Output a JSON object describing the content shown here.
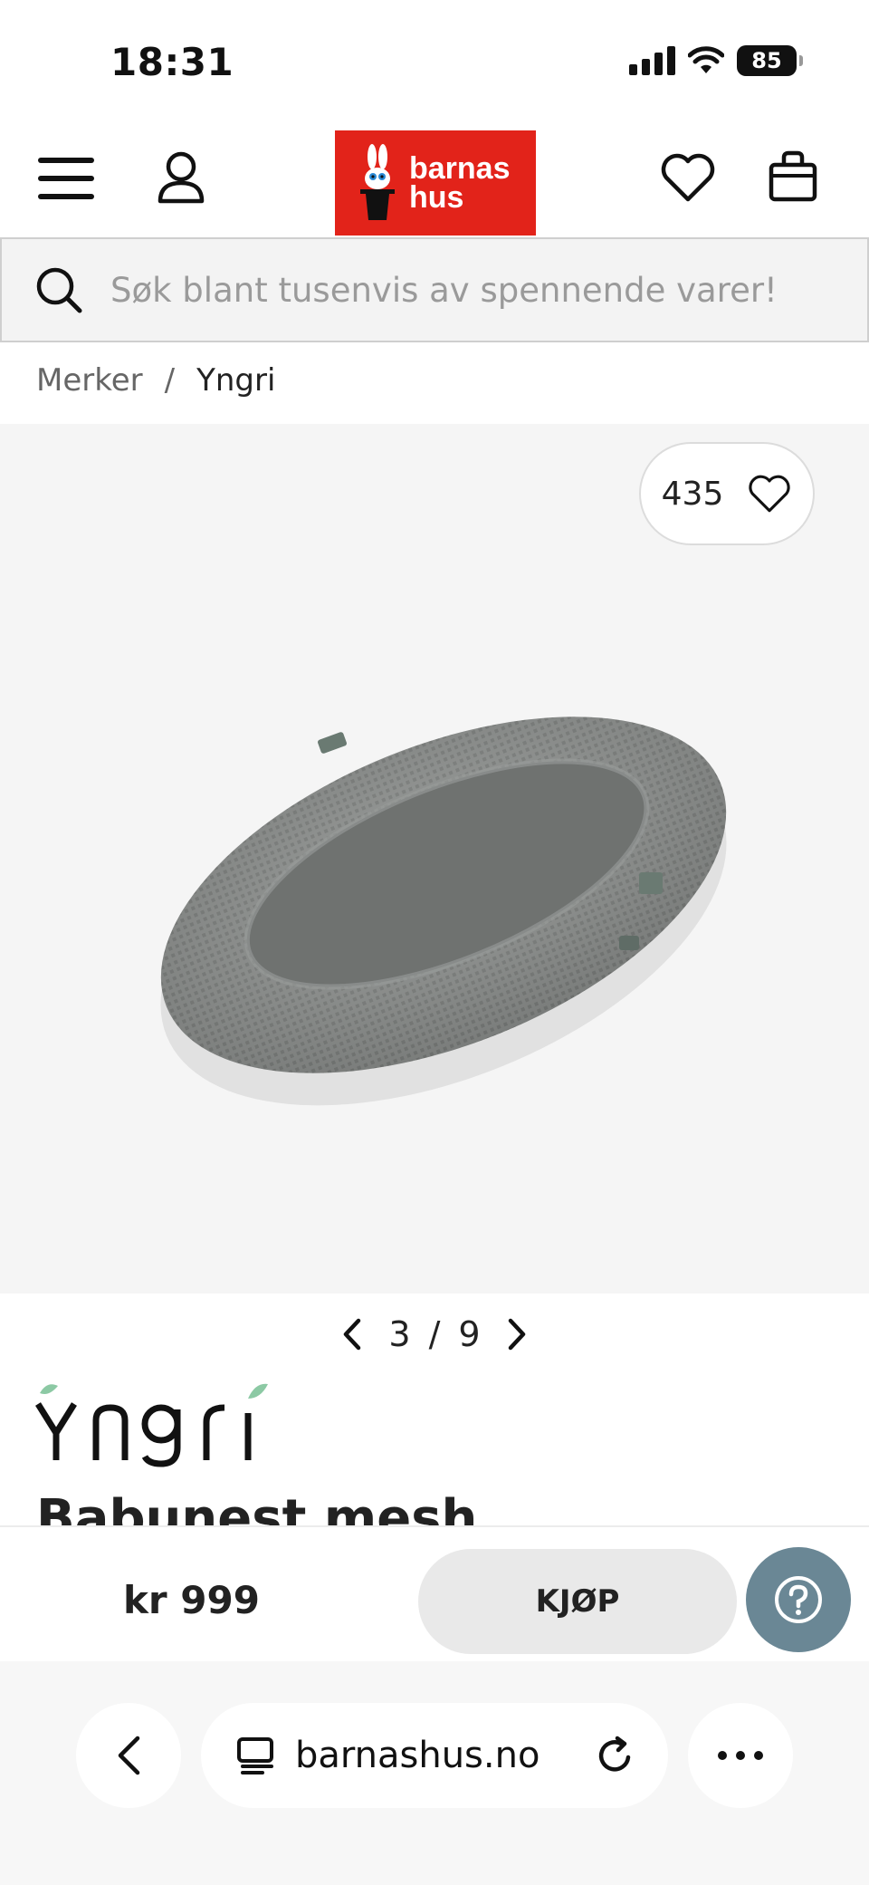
{
  "status_bar": {
    "time": "18:31",
    "battery": "85"
  },
  "header": {
    "logo_line1": "barnas",
    "logo_line2": "hus",
    "icons": [
      "menu-icon",
      "user-icon",
      "heart-icon",
      "bag-icon"
    ],
    "brand_color": "#e2231a"
  },
  "search": {
    "placeholder": "Søk blant tusenvis av spennende varer!"
  },
  "breadcrumb": {
    "items": [
      "Merker",
      "Yngri"
    ],
    "separator": "/"
  },
  "gallery": {
    "favorites_count": "435",
    "current": "3",
    "total": "9",
    "separator": "/"
  },
  "product": {
    "brand": "Yngri",
    "title": "Babunest mesh",
    "price": "kr 999"
  },
  "buy_bar": {
    "buy_label": "KJØP",
    "help_color": "#6a8795"
  },
  "browser": {
    "url": "barnashus.no"
  }
}
